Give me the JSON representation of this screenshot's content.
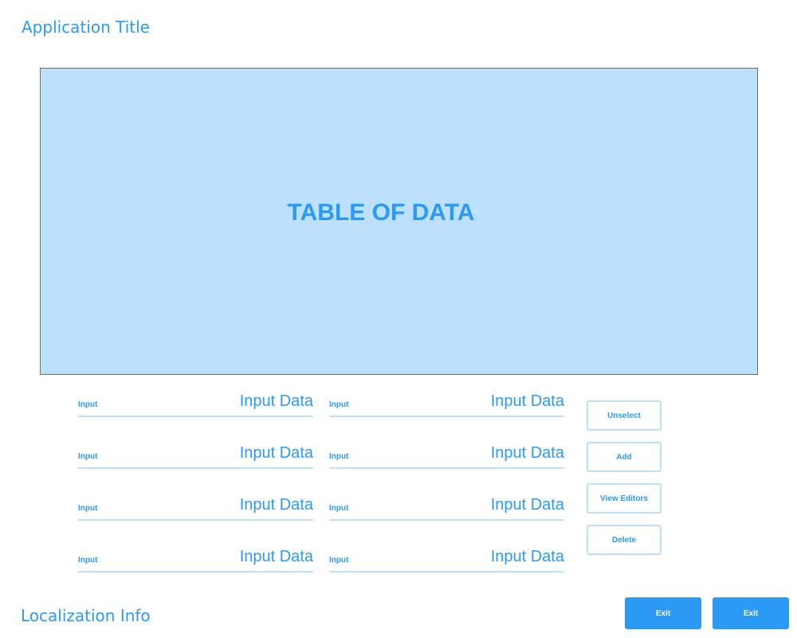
{
  "header": {
    "title": "Application Title"
  },
  "table": {
    "placeholder": "TABLE OF DATA"
  },
  "form": {
    "fields": [
      {
        "label": "Input",
        "value": "Input Data"
      },
      {
        "label": "Input",
        "value": "Input Data"
      },
      {
        "label": "Input",
        "value": "Input Data"
      },
      {
        "label": "Input",
        "value": "Input Data"
      },
      {
        "label": "Input",
        "value": "Input Data"
      },
      {
        "label": "Input",
        "value": "Input Data"
      },
      {
        "label": "Input",
        "value": "Input Data"
      },
      {
        "label": "Input",
        "value": "Input Data"
      }
    ]
  },
  "actions": {
    "unselect": "Unselect",
    "add": "Add",
    "view_editors": "View Editors",
    "delete": "Delete"
  },
  "footer": {
    "localization": "Localization Info",
    "exit_1": "Exit",
    "exit_2": "Exit"
  },
  "colors": {
    "accent": "#2a9af5",
    "light_accent": "#bde0fd"
  }
}
